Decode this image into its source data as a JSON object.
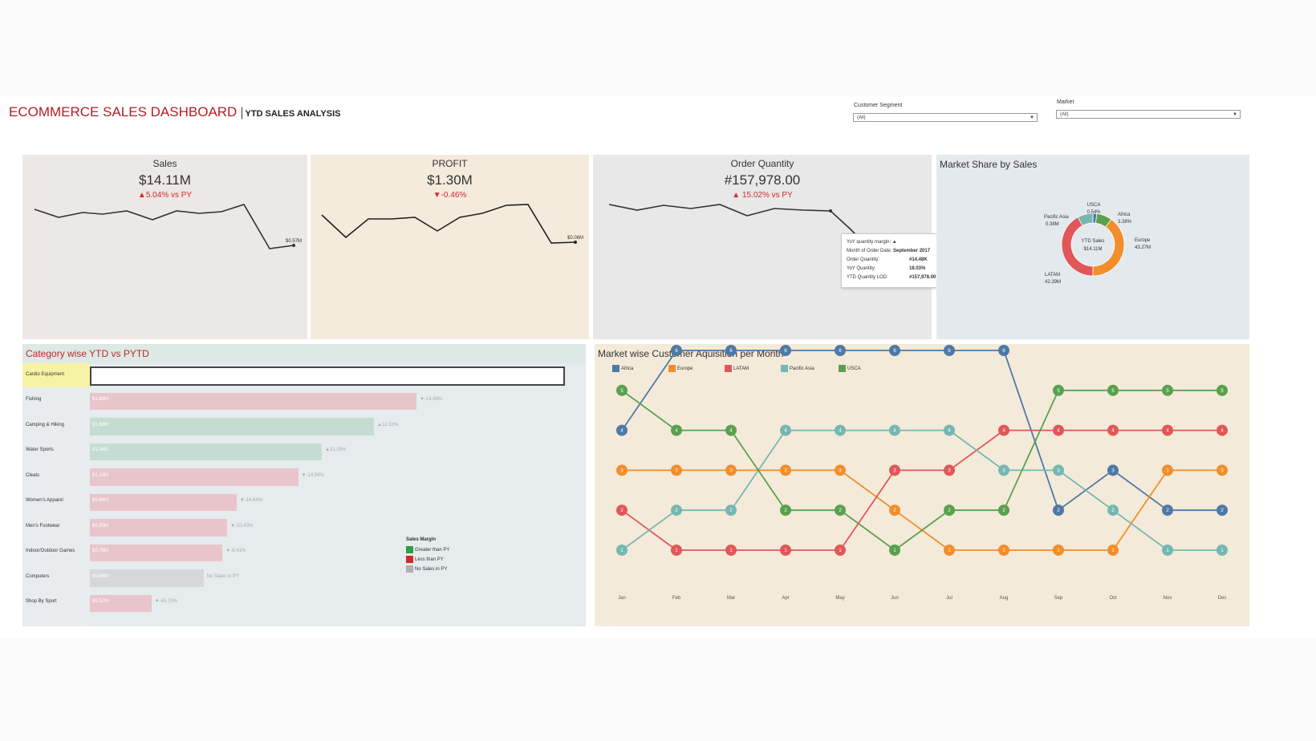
{
  "header": {
    "title": "ECOMMERCE SALES DASHBOARD",
    "separator": "|",
    "subtitle": "YTD SALES ANALYSIS"
  },
  "filters": [
    {
      "label": "Customer Segment",
      "value": "(All)"
    },
    {
      "label": "Market",
      "value": "(All)"
    }
  ],
  "kpis": {
    "sales": {
      "title": "Sales",
      "value": "$14.11M",
      "change": "▲5.04% vs PY",
      "end_label": "$0.57M"
    },
    "profit": {
      "title": "PROFIT",
      "value": "$1.30M",
      "change": "▼-0.46%",
      "end_label": "$0.06M"
    },
    "order_quantity": {
      "title": "Order Quantity",
      "value": "#157,978.00",
      "change": "▲ 15.02% vs PY"
    }
  },
  "tooltip": {
    "rows": [
      {
        "label": "YoY quantity margin:",
        "value": "▲"
      },
      {
        "label": "Month of Order Date:",
        "value": "September 2017"
      },
      {
        "label": "Order Quantity:",
        "value": "#14.48K"
      },
      {
        "label": "YoY Quantity:",
        "value": "18.03%"
      },
      {
        "label": "YTD Quantity LOD:",
        "value": "#157,978.00"
      }
    ]
  },
  "market_share": {
    "title": "Market Share by Sales",
    "center_line1": "YTD Sales",
    "center_line2": "$14.11M",
    "labels": [
      {
        "name": "USCA",
        "value": "0.54%"
      },
      {
        "name": "Africa",
        "value": "3.38%"
      },
      {
        "name": "Europe",
        "value": "43.27M"
      },
      {
        "name": "LATAM",
        "value": "42.39M"
      },
      {
        "name": "Pacific Asia",
        "value": "0.38M"
      }
    ],
    "slices": [
      {
        "name": "USCA",
        "fraction": 0.02,
        "color": "#4e79a7"
      },
      {
        "name": "Africa",
        "fraction": 0.08,
        "color": "#59a14f"
      },
      {
        "name": "Europe",
        "fraction": 0.4,
        "color": "#f28e2b"
      },
      {
        "name": "LATAM",
        "fraction": 0.42,
        "color": "#e15759"
      },
      {
        "name": "Pacific Asia",
        "fraction": 0.08,
        "color": "#76b7b2"
      }
    ]
  },
  "category": {
    "title": "Category wise YTD vs PYTD",
    "items": [
      {
        "name": "Cardio Equipment",
        "bar": "",
        "delta": "",
        "status": "highlight",
        "value": 1.0
      },
      {
        "name": "Fishing",
        "bar": "$1.86M",
        "delta": "▼-14.66%",
        "status": "less",
        "value": 0.69
      },
      {
        "name": "Camping & Hiking",
        "bar": "$1.66M",
        "delta": "▲12.53%",
        "status": "greater",
        "value": 0.6
      },
      {
        "name": "Water Sports",
        "bar": "$1.34M",
        "delta": "▲31.25%",
        "status": "greater",
        "value": 0.49
      },
      {
        "name": "Cleats",
        "bar": "$1.18M",
        "delta": "▼-14.56%",
        "status": "less",
        "value": 0.44
      },
      {
        "name": "Women's Apparel",
        "bar": "$0.84M",
        "delta": "▼-14.64%",
        "status": "less",
        "value": 0.31
      },
      {
        "name": "Men's Footwear",
        "bar": "$0.80M",
        "delta": "▼-20.43%",
        "status": "less",
        "value": 0.29
      },
      {
        "name": "Indoor/Outdoor Games",
        "bar": "$0.78M",
        "delta": "▼-6.41%",
        "status": "less",
        "value": 0.28
      },
      {
        "name": "Computers",
        "bar": "$0.66M",
        "delta": "No Sales in PY",
        "status": "nosales",
        "value": 0.24
      },
      {
        "name": "Shop By Sport",
        "bar": "$0.37M",
        "delta": "▼-65.70%",
        "status": "less",
        "value": 0.13
      }
    ],
    "legend": {
      "title": "Sales Margin",
      "items": [
        {
          "label": "Greater than PY",
          "color": "#2e9e44"
        },
        {
          "label": "Less than PY",
          "color": "#d62728"
        },
        {
          "label": "No Sales in PY",
          "color": "#b0b0b0"
        }
      ]
    },
    "colors": {
      "greater": "#c5ddd0",
      "less": "#e8c5ca",
      "nosales": "#d5d8da"
    }
  },
  "acquisition": {
    "title": "Market wise Customer Aquisition per Month",
    "months": [
      "Jan",
      "Feb",
      "Mar",
      "Apr",
      "May",
      "Jun",
      "Jul",
      "Aug",
      "Sep",
      "Oct",
      "Nov",
      "Dec"
    ],
    "series": [
      {
        "name": "Africa",
        "color": "#4e79a7",
        "ranks": [
          4,
          6,
          6,
          6,
          6,
          6,
          6,
          6,
          2,
          3,
          2,
          2
        ]
      },
      {
        "name": "Europe",
        "color": "#f28e2b",
        "ranks": [
          3,
          3,
          3,
          3,
          3,
          2,
          1,
          1,
          1,
          1,
          3,
          3
        ]
      },
      {
        "name": "LATAM",
        "color": "#e15759",
        "ranks": [
          2,
          1,
          1,
          1,
          1,
          3,
          3,
          4,
          4,
          4,
          4,
          4
        ]
      },
      {
        "name": "Pacific Asia",
        "color": "#76b7b2",
        "ranks": [
          1,
          2,
          2,
          4,
          4,
          4,
          4,
          3,
          3,
          2,
          1,
          1
        ]
      },
      {
        "name": "USCA",
        "color": "#59a14f",
        "ranks": [
          5,
          4,
          4,
          2,
          2,
          1,
          2,
          2,
          5,
          5,
          5,
          5
        ]
      }
    ]
  }
}
